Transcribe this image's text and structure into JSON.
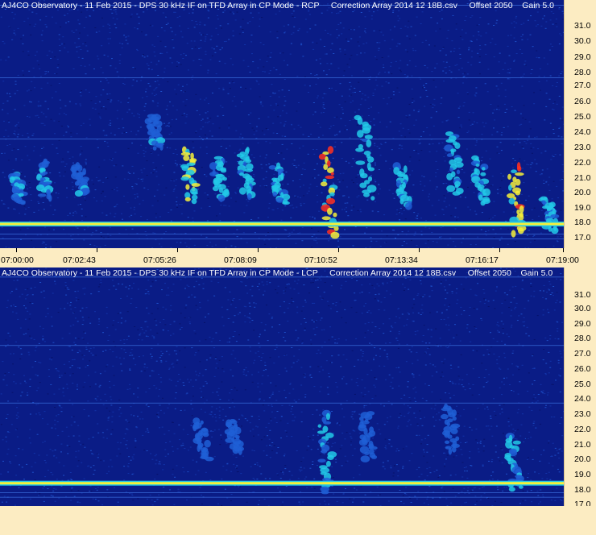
{
  "panels": [
    {
      "id": "rcp",
      "title": "AJ4CO Observatory - 11 Feb 2015 - DPS 30 kHz IF on TFD Array in CP Mode - RCP     Correction Array 2014 12 18B.csv     Offset 2050    Gain 5.0",
      "freq_ticks": [
        "31.0",
        "30.0",
        "29.0",
        "28.0",
        "27.0",
        "26.0",
        "25.0",
        "24.0",
        "23.0",
        "22.0",
        "21.0",
        "20.0",
        "19.0",
        "18.0",
        "17.0"
      ],
      "time_ticks": [
        "07:00:00",
        "07:02:43",
        "07:05:26",
        "07:08:09",
        "07:10:52",
        "07:13:34",
        "07:16:17",
        "07:19:00"
      ]
    },
    {
      "id": "lcp",
      "title": "AJ4CO Observatory - 11 Feb 2015 - DPS 30 kHz IF on TFD Array in CP Mode - LCP     Correction Array 2014 12 18B.csv     Offset 2050    Gain 5.0",
      "freq_ticks": [
        "31.0",
        "30.0",
        "29.0",
        "28.0",
        "27.0",
        "26.0",
        "25.0",
        "24.0",
        "23.0",
        "22.0",
        "21.0",
        "20.0",
        "19.0",
        "18.0",
        "17.0"
      ],
      "time_ticks": []
    }
  ],
  "chart_data": [
    {
      "type": "heatmap",
      "title": "AJ4CO Observatory - 11 Feb 2015 - DPS 30 kHz IF on TFD Array in CP Mode - RCP",
      "xlabel": "",
      "ylabel": "",
      "x_ticks": [
        "07:00:00",
        "07:02:43",
        "07:05:26",
        "07:08:09",
        "07:10:52",
        "07:13:34",
        "07:16:17",
        "07:19:00"
      ],
      "y_ticks": [
        31.0,
        30.0,
        29.0,
        28.0,
        27.0,
        26.0,
        25.0,
        24.0,
        23.0,
        22.0,
        21.0,
        20.0,
        19.0,
        18.0,
        17.0
      ],
      "ylim": [
        16.4,
        31.8
      ],
      "colormap": [
        "#0b1e8a",
        "#1f5fd6",
        "#22c9e8",
        "#f6f03a",
        "#ff3020"
      ],
      "persistent_line_mhz": 17.9,
      "bursts": [
        {
          "t_min": 0.6,
          "f_lo": 19.2,
          "f_hi": 21.0,
          "level": 0.45
        },
        {
          "t_min": 1.5,
          "f_lo": 19.5,
          "f_hi": 21.8,
          "level": 0.45
        },
        {
          "t_min": 2.7,
          "f_lo": 19.8,
          "f_hi": 21.5,
          "level": 0.4
        },
        {
          "t_min": 5.2,
          "f_lo": 22.6,
          "f_hi": 24.6,
          "level": 0.4
        },
        {
          "t_min": 6.4,
          "f_lo": 19.3,
          "f_hi": 22.5,
          "level": 0.8
        },
        {
          "t_min": 7.4,
          "f_lo": 19.5,
          "f_hi": 22.0,
          "level": 0.55
        },
        {
          "t_min": 8.3,
          "f_lo": 19.6,
          "f_hi": 22.5,
          "level": 0.6
        },
        {
          "t_min": 9.4,
          "f_lo": 19.2,
          "f_hi": 21.5,
          "level": 0.5
        },
        {
          "t_min": 11.1,
          "f_lo": 17.2,
          "f_hi": 22.5,
          "level": 0.95
        },
        {
          "t_min": 12.3,
          "f_lo": 19.5,
          "f_hi": 24.5,
          "level": 0.65
        },
        {
          "t_min": 13.6,
          "f_lo": 19.0,
          "f_hi": 21.5,
          "level": 0.55
        },
        {
          "t_min": 15.3,
          "f_lo": 19.8,
          "f_hi": 23.5,
          "level": 0.55
        },
        {
          "t_min": 16.2,
          "f_lo": 19.2,
          "f_hi": 22.0,
          "level": 0.6
        },
        {
          "t_min": 17.4,
          "f_lo": 17.3,
          "f_hi": 21.5,
          "level": 0.95
        },
        {
          "t_min": 18.5,
          "f_lo": 17.5,
          "f_hi": 19.5,
          "level": 0.55
        }
      ]
    },
    {
      "type": "heatmap",
      "title": "AJ4CO Observatory - 11 Feb 2015 - DPS 30 kHz IF on TFD Array in CP Mode - LCP",
      "xlabel": "",
      "ylabel": "",
      "x_ticks": [],
      "y_ticks": [
        31.0,
        30.0,
        29.0,
        28.0,
        27.0,
        26.0,
        25.0,
        24.0,
        23.0,
        22.0,
        21.0,
        20.0,
        19.0,
        18.0,
        17.0
      ],
      "ylim": [
        16.4,
        32.1
      ],
      "colormap": [
        "#0b1e8a",
        "#1f5fd6",
        "#22c9e8",
        "#f6f03a",
        "#ff3020"
      ],
      "persistent_line_mhz": 17.9,
      "bursts": [
        {
          "t_min": 6.8,
          "f_lo": 19.5,
          "f_hi": 22.0,
          "level": 0.3
        },
        {
          "t_min": 7.9,
          "f_lo": 20.0,
          "f_hi": 22.0,
          "level": 0.25
        },
        {
          "t_min": 11.0,
          "f_lo": 17.3,
          "f_hi": 22.5,
          "level": 0.45
        },
        {
          "t_min": 12.4,
          "f_lo": 19.5,
          "f_hi": 22.5,
          "level": 0.3
        },
        {
          "t_min": 15.2,
          "f_lo": 20.0,
          "f_hi": 23.0,
          "level": 0.25
        },
        {
          "t_min": 17.3,
          "f_lo": 17.5,
          "f_hi": 21.0,
          "level": 0.55
        }
      ]
    }
  ]
}
